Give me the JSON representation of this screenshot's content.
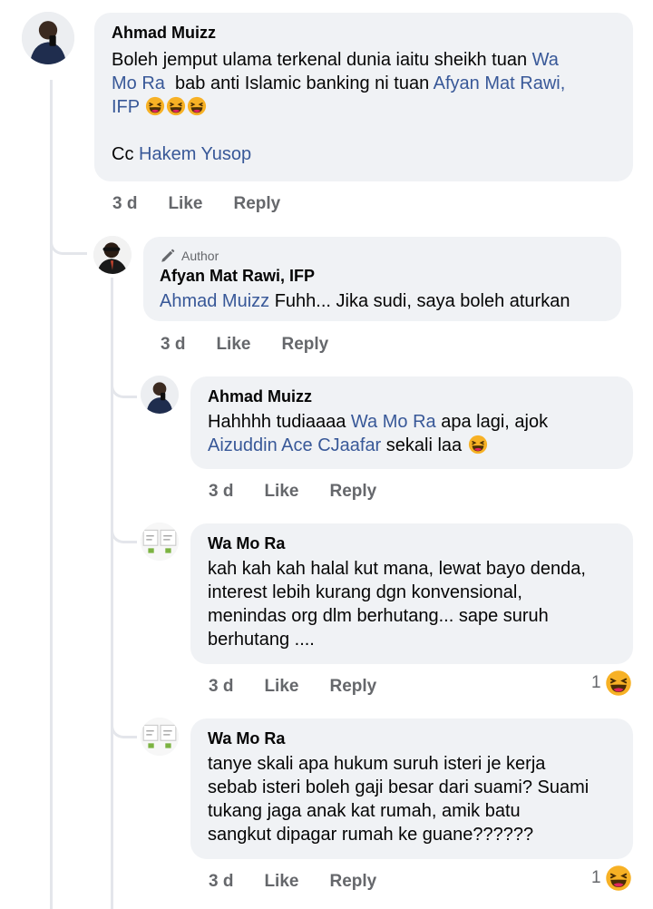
{
  "comments": [
    {
      "name": "Ahmad Muizz",
      "line1_a": "Boleh jemput ulama terkenal dunia iaitu sheikh tuan ",
      "line1_m": "Wa",
      "line2_m": "Mo Ra",
      "line2_a": "  bab anti Islamic banking ni tuan ",
      "line2_m2": "Afyan Mat Rawi,",
      "line3_m": "IFP",
      "line5_a": "Cc ",
      "line5_m": "Hakem Yusop",
      "time": "3 d",
      "like": "Like",
      "reply": "Reply"
    },
    {
      "author_label": "Author",
      "name": "Afyan Mat Rawi, IFP",
      "mention": "Ahmad Muizz",
      "text": " Fuhh... Jika sudi, saya boleh aturkan",
      "time": "3 d",
      "like": "Like",
      "reply": "Reply"
    },
    {
      "name": "Ahmad Muizz",
      "line1_a": "Hahhhh tudiaaaa ",
      "line1_m": "Wa Mo Ra",
      "line1_b": " apa lagi, ajok",
      "line2_m": "Aizuddin Ace CJaafar",
      "line2_a": " sekali laa",
      "time": "3 d",
      "like": "Like",
      "reply": "Reply"
    },
    {
      "name": "Wa Mo Ra",
      "lines": [
        "kah kah kah halal kut mana, lewat bayo denda,",
        "interest lebih kurang dgn konvensional,",
        "menindas org dlm berhutang... sape suruh",
        "berhutang ...."
      ],
      "time": "3 d",
      "like": "Like",
      "reply": "Reply",
      "reaction_count": "1"
    },
    {
      "name": "Wa Mo Ra",
      "lines": [
        "tanye skali apa hukum suruh isteri je kerja",
        "sebab isteri boleh gaji besar dari suami? Suami",
        "tukang jaga anak kat rumah, amik batu",
        "sangkut dipagar rumah ke guane??????"
      ],
      "time": "3 d",
      "like": "Like",
      "reply": "Reply",
      "reaction_count": "1"
    }
  ],
  "colors": {
    "bubble": "#f0f2f5",
    "mention": "#385898",
    "meta": "#65676b",
    "reaction": "#f7b125"
  }
}
